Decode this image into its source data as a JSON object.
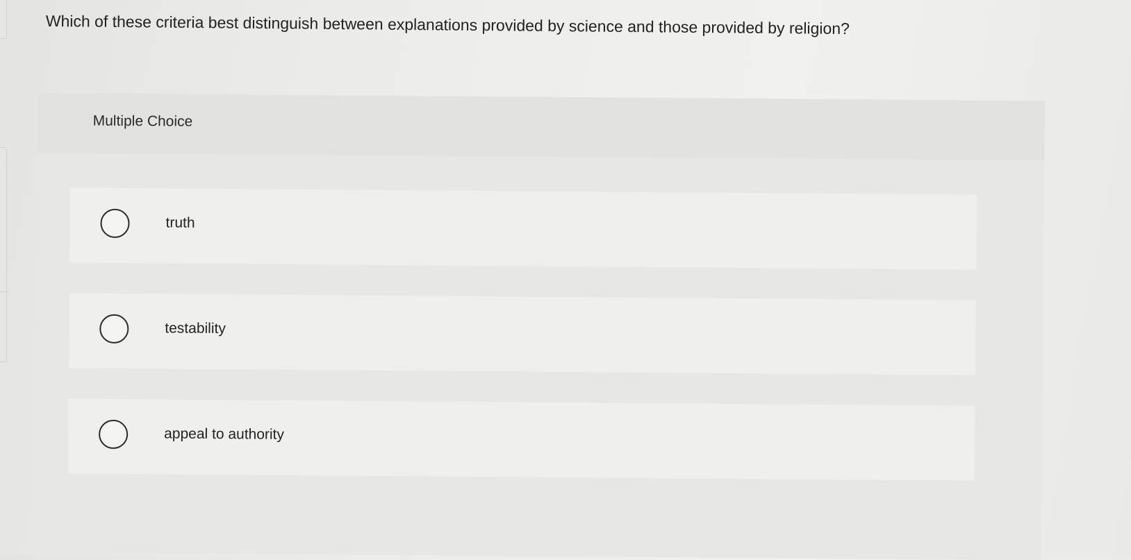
{
  "question": {
    "text": "Which of these criteria best distinguish between explanations provided by science and those provided by religion?"
  },
  "multiple_choice": {
    "label": "Multiple Choice",
    "options": [
      {
        "label": "truth"
      },
      {
        "label": "testability"
      },
      {
        "label": "appeal to authority"
      }
    ]
  },
  "icons": {
    "radio": "radio-unselected-icon"
  }
}
